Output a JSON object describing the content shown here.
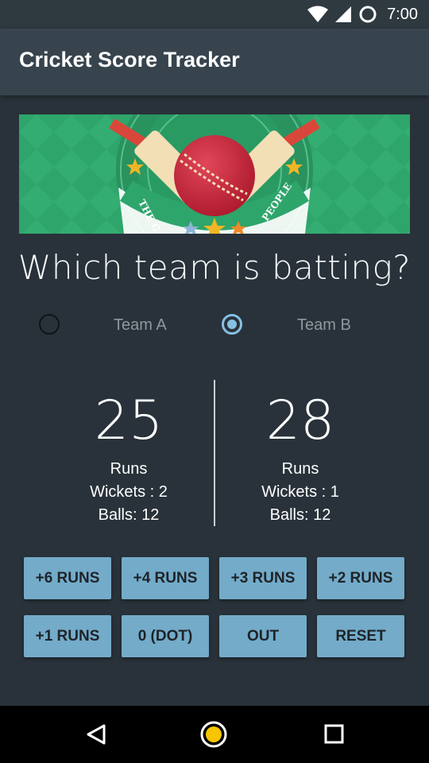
{
  "status_bar": {
    "time": "7:00",
    "icons": [
      "wifi-icon",
      "cell-signal-icon",
      "circle-notification-icon"
    ]
  },
  "app_bar": {
    "title": "Cricket Score Tracker"
  },
  "banner": {
    "text_left": "THE G",
    "text_right": "PEOPLE",
    "colors": {
      "green": "#2ea56b",
      "ball": "#c8233a",
      "bat": "#f3dfb5"
    }
  },
  "question": "Which team is batting?",
  "teams": [
    {
      "label": "Team A",
      "selected": false
    },
    {
      "label": "Team B",
      "selected": true
    }
  ],
  "scores": {
    "team_a": {
      "runs": "25",
      "runs_label": "Runs",
      "wickets": "Wickets : 2",
      "balls": "Balls: 12"
    },
    "team_b": {
      "runs": "28",
      "runs_label": "Runs",
      "wickets": "Wickets : 1",
      "balls": "Balls: 12"
    }
  },
  "buttons": {
    "row1": [
      "+6 RUNS",
      "+4 RUNS",
      "+3 RUNS",
      "+2 RUNS"
    ],
    "row2": [
      "+1 RUNS",
      "0 (DOT)",
      "OUT",
      "RESET"
    ]
  },
  "nav_bar": {
    "icons": [
      "back-icon",
      "home-icon",
      "recents-icon"
    ]
  },
  "colors": {
    "background": "#29323a",
    "app_bar": "#37444d",
    "button": "#73abc9",
    "radio_selected": "#86c0e4"
  }
}
